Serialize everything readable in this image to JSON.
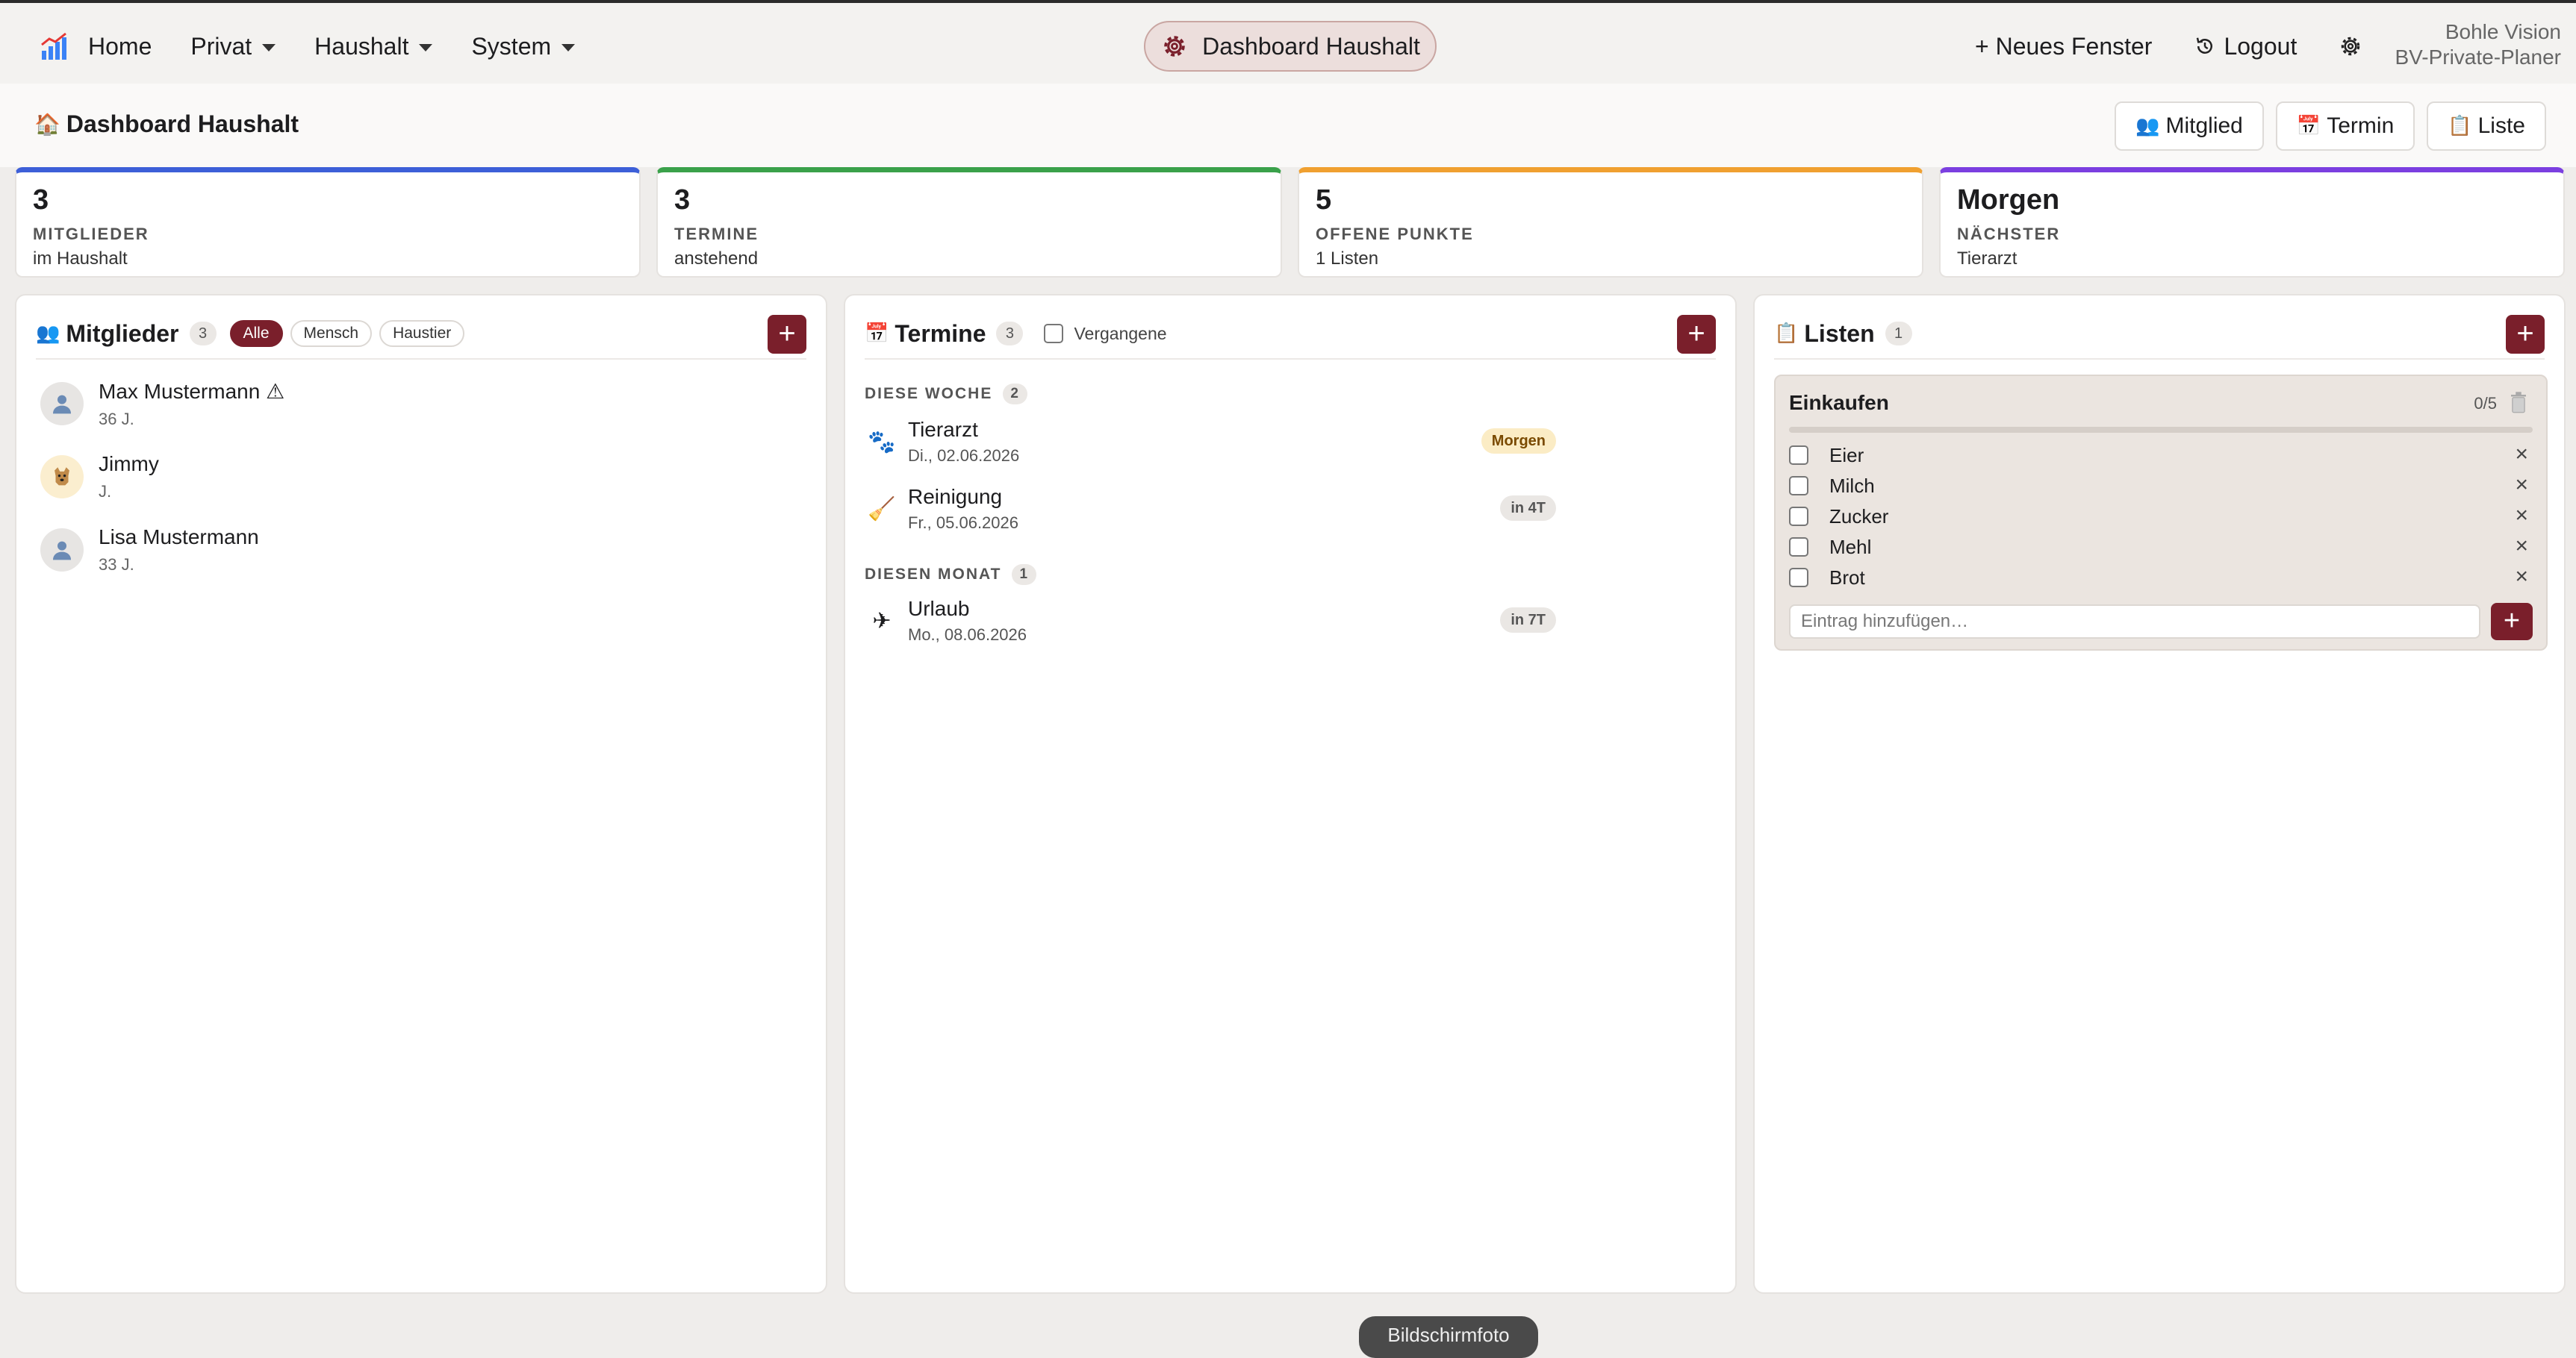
{
  "nav": {
    "home": "Home",
    "menus": [
      "Privat",
      "Haushalt",
      "System"
    ],
    "center_title": "Dashboard Haushalt",
    "new_window": "+ Neues Fenster",
    "logout": "Logout",
    "brand_line1": "Bohle Vision",
    "brand_line2": "BV-Private-Planer"
  },
  "header": {
    "title": "Dashboard Haushalt",
    "title_icon": "🏠",
    "actions": [
      {
        "icon": "👥",
        "label": "Mitglied"
      },
      {
        "icon": "📅",
        "label": "Termin"
      },
      {
        "icon": "📋",
        "label": "Liste"
      }
    ]
  },
  "stats": [
    {
      "value": "3",
      "label": "MITGLIEDER",
      "sub": "im Haushalt",
      "color": "#3d5fd8"
    },
    {
      "value": "3",
      "label": "TERMINE",
      "sub": "anstehend",
      "color": "#3aa14a"
    },
    {
      "value": "5",
      "label": "OFFENE PUNKTE",
      "sub": "1 Listen",
      "color": "#f0a030"
    },
    {
      "value": "Morgen",
      "label": "NÄCHSTER",
      "sub": "Tierarzt",
      "color": "#7b3fe0"
    }
  ],
  "members_panel": {
    "title": "Mitglieder",
    "icon": "👥",
    "count": "3",
    "filters": [
      "Alle",
      "Mensch",
      "Haustier"
    ],
    "active_filter": "Alle",
    "items": [
      {
        "name": "Max Mustermann ⚠",
        "age": "36 J.",
        "type": "person-icon"
      },
      {
        "name": "Jimmy",
        "age": "J.",
        "type": "dog-icon"
      },
      {
        "name": "Lisa Mustermann",
        "age": "33 J.",
        "type": "person-icon"
      }
    ]
  },
  "events_panel": {
    "title": "Termine",
    "icon": "📅",
    "count": "3",
    "past_label": "Vergangene",
    "sections": [
      {
        "label": "DIESE WOCHE",
        "count": "2",
        "events": [
          {
            "icon": "🐾",
            "title": "Tierarzt",
            "date": "Di., 02.06.2026",
            "badge": "Morgen"
          },
          {
            "icon": "🧹",
            "title": "Reinigung",
            "date": "Fr., 05.06.2026",
            "badge": "in 4T"
          }
        ]
      },
      {
        "label": "DIESEN MONAT",
        "count": "1",
        "events": [
          {
            "icon": "✈",
            "title": "Urlaub",
            "date": "Mo., 08.06.2026",
            "badge": "in 7T"
          }
        ]
      }
    ]
  },
  "lists_panel": {
    "title": "Listen",
    "icon": "📋",
    "count": "1",
    "list": {
      "title": "Einkaufen",
      "progress_text": "0/5",
      "progress": 0,
      "items": [
        "Eier",
        "Milch",
        "Zucker",
        "Mehl",
        "Brot"
      ],
      "add_placeholder": "Eintrag hinzufügen…"
    }
  },
  "footer": {
    "screenshot_label": "Bildschirmfoto"
  },
  "colors": {
    "accent": "#7a1f2b"
  }
}
